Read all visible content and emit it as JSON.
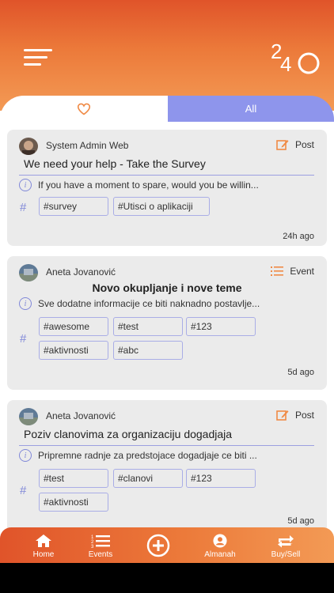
{
  "header": {
    "logo_text": "2440",
    "menu_icon": "hamburger-icon"
  },
  "tabs": {
    "favorites_icon": "heart-icon",
    "all_label": "All"
  },
  "posts": [
    {
      "author": "System Admin Web",
      "type_label": "Post",
      "type_icon": "edit-icon",
      "title": "We need your help - Take the Survey",
      "excerpt": "If you have a moment to spare, would you be willin...",
      "tags": [
        "#survey",
        "#Utisci o aplikaciji"
      ],
      "time": "24h ago"
    },
    {
      "author": "Aneta Jovanović",
      "type_label": "Event",
      "type_icon": "list-icon",
      "title": "Novo okupljanje i nove teme",
      "excerpt": "Sve dodatne informacije ce biti naknadno postavlje...",
      "tags": [
        "#awesome",
        "#test",
        "#123",
        "#aktivnosti",
        "#abc"
      ],
      "time": "5d ago"
    },
    {
      "author": "Aneta Jovanović",
      "type_label": "Post",
      "type_icon": "edit-icon",
      "title": "Poziv clanovima za organizaciju dogadjaja",
      "excerpt": "Pripremne radnje za predstojace dogadjaje ce biti ...",
      "tags": [
        "#test",
        "#clanovi",
        "#123",
        "#aktivnosti"
      ],
      "time": "5d ago"
    }
  ],
  "bottom_nav": {
    "home": "Home",
    "events": "Events",
    "add_icon": "plus-circle-icon",
    "almanah": "Almanah",
    "buysell": "Buy/Sell"
  },
  "colors": {
    "accent": "#e0542a",
    "accent_light": "#f39a55",
    "purple": "#8e95ec",
    "card_bg": "#ebebeb"
  }
}
